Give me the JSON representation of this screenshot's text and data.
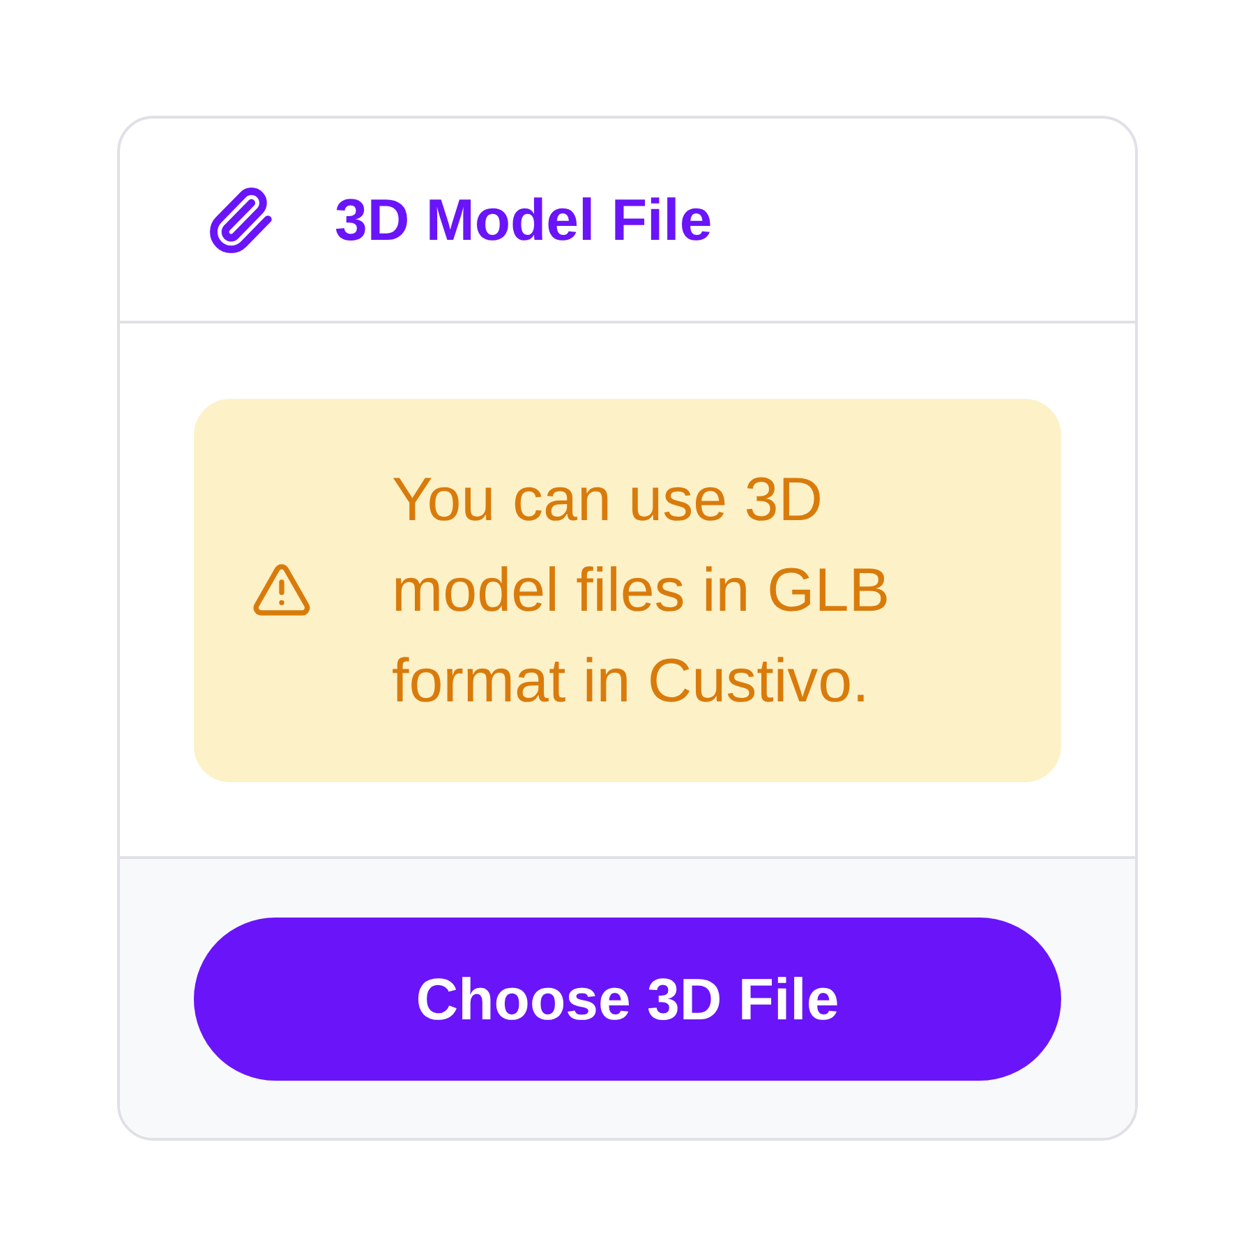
{
  "header": {
    "title": "3D Model File"
  },
  "notice": {
    "kind": "warning",
    "text": "You can use 3D model files in GLB format in Custivo."
  },
  "footer": {
    "button": {
      "label": "Choose 3D File"
    }
  }
}
